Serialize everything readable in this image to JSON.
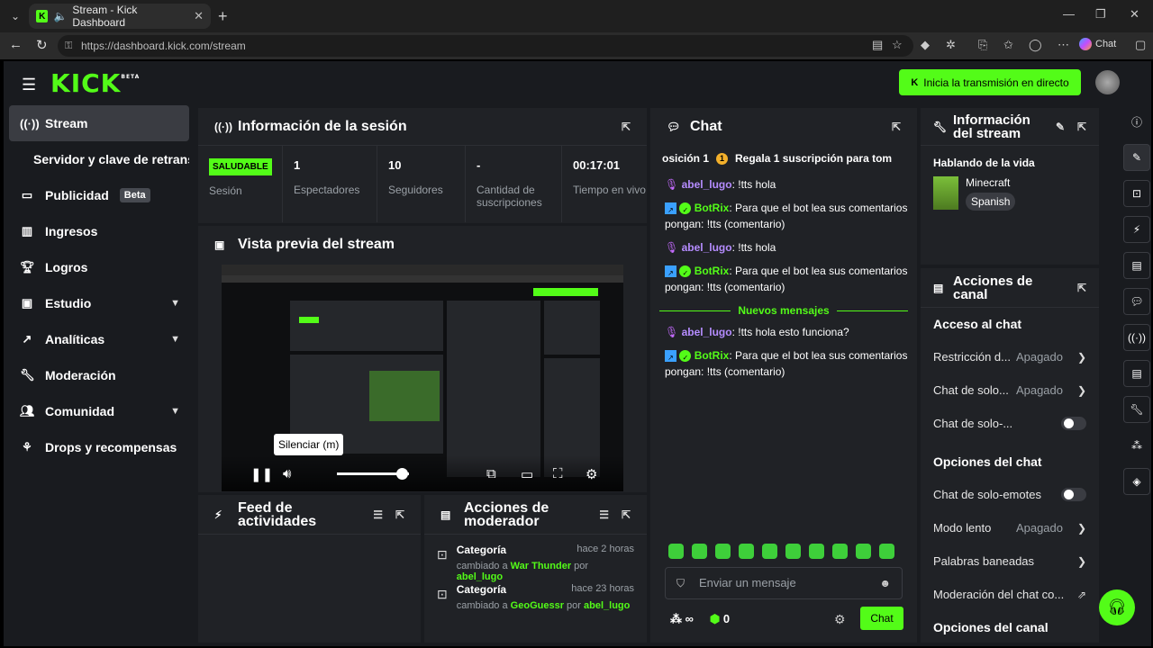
{
  "browser": {
    "tab_title": "Stream - Kick Dashboard",
    "url": "https://dashboard.kick.com/stream",
    "chat_button_label": "Chat"
  },
  "header": {
    "logo_text": "KICK",
    "logo_badge": "BETA",
    "go_live_label": "Inicia la transmisión en directo"
  },
  "sidebar": {
    "items": [
      {
        "label": "Stream"
      },
      {
        "label": "Servidor y clave de retransmisión"
      },
      {
        "label": "Publicidad",
        "badge": "Beta"
      },
      {
        "label": "Ingresos"
      },
      {
        "label": "Logros"
      },
      {
        "label": "Estudio"
      },
      {
        "label": "Analíticas"
      },
      {
        "label": "Moderación"
      },
      {
        "label": "Comunidad"
      },
      {
        "label": "Drops y recompensas"
      }
    ]
  },
  "session": {
    "title": "Información de la sesión",
    "status_badge": "SALUDABLE",
    "stats": [
      {
        "value": "",
        "label": "Sesión"
      },
      {
        "value": "1",
        "label": "Espectadores"
      },
      {
        "value": "10",
        "label": "Seguidores"
      },
      {
        "value": "-",
        "label": "Cantidad de suscripciones"
      },
      {
        "value": "00:17:01",
        "label": "Tiempo en vivo"
      }
    ]
  },
  "preview": {
    "title": "Vista previa del stream",
    "tooltip": "Silenciar (m)",
    "volume_level": 0.9
  },
  "activity_feed": {
    "title": "Feed de actividades"
  },
  "mod_actions": {
    "title": "Acciones de moderador",
    "rows": [
      {
        "title": "Categoría",
        "when": "hace 2 horas",
        "prefix": "cambiado a",
        "target": "War Thunder",
        "by_word": "por",
        "user": "abel_lugo"
      },
      {
        "title": "Categoría",
        "when": "hace 23 horas",
        "prefix": "cambiado a",
        "target": "GeoGuessr",
        "by_word": "por",
        "user": "abel_lugo"
      }
    ]
  },
  "chat": {
    "title": "Chat",
    "gift_position": "osición 1",
    "gift_text": "Regala 1 suscripción para tom",
    "messages": [
      {
        "user": "abel_lugo",
        "text": "!tts hola"
      },
      {
        "user": "BotRix",
        "text": "Para que el bot lea sus comentarios pongan: !tts (comentario)"
      },
      {
        "user": "abel_lugo",
        "text": "!tts hola"
      },
      {
        "user": "BotRix",
        "text": "Para que el bot lea sus comentarios pongan: !tts (comentario)"
      }
    ],
    "new_messages_label": "Nuevos mensajes",
    "new_messages": [
      {
        "user": "abel_lugo",
        "text": "!tts hola esto funciona?"
      },
      {
        "user": "BotRix",
        "text": "Para que el bot lea sus comentarios pongan: !tts (comentario)"
      }
    ],
    "input_placeholder": "Enviar un mensaje",
    "infinity": "∞",
    "points": "0",
    "send_label": "Chat"
  },
  "stream_info": {
    "title": "Información del stream",
    "stream_title": "Hablando de la vida",
    "category": "Minecraft",
    "language": "Spanish"
  },
  "channel_actions": {
    "title": "Acciones de canal",
    "chat_access_title": "Acceso al chat",
    "chat_access": [
      {
        "label": "Restricción d...",
        "value": "Apagado"
      },
      {
        "label": "Chat de solo...",
        "value": "Apagado"
      },
      {
        "label": "Chat de solo-...",
        "value": ""
      }
    ],
    "chat_options_title": "Opciones del chat",
    "chat_options": [
      {
        "label": "Chat de solo-emotes",
        "value": ""
      },
      {
        "label": "Modo lento",
        "value": "Apagado"
      },
      {
        "label": "Palabras baneadas",
        "value": ""
      },
      {
        "label": "Moderación del chat co...",
        "value": ""
      }
    ],
    "channel_options_title": "Opciones del canal"
  }
}
